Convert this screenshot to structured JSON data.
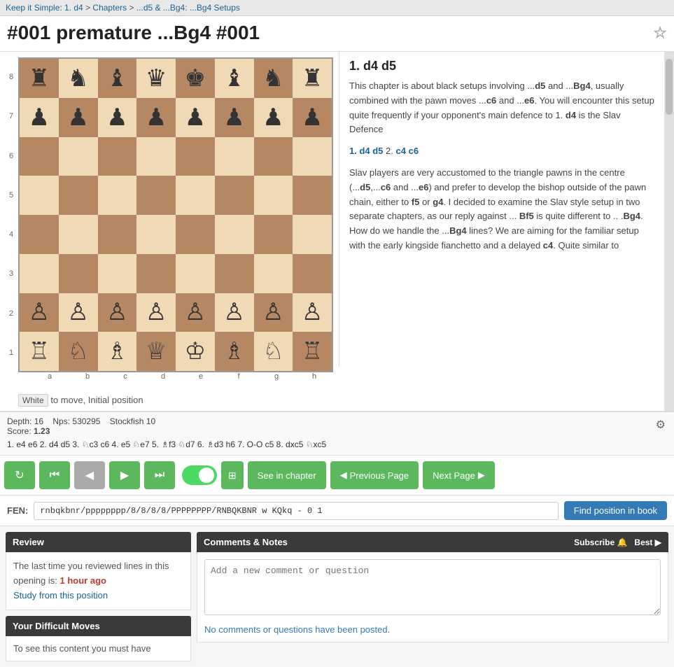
{
  "breadcrumb": {
    "items": [
      {
        "label": "Keep it Simple: 1. d4",
        "href": "#"
      },
      {
        "label": "Chapters",
        "href": "#"
      },
      {
        "label": "...d5 & ...Bg4: ...Bg4 Setups",
        "href": "#"
      }
    ],
    "separators": [
      " > ",
      " > "
    ]
  },
  "page": {
    "title": "#001 premature ...Bg4 #001",
    "star_label": "☆"
  },
  "board": {
    "status_color": "White",
    "status_text": "to move, Initial position",
    "col_labels": [
      "a",
      "b",
      "c",
      "d",
      "e",
      "f",
      "g",
      "h"
    ],
    "row_labels": [
      "8",
      "7",
      "6",
      "5",
      "4",
      "3",
      "2",
      "1"
    ]
  },
  "text_panel": {
    "move_header": "1. d4  d5",
    "paragraphs": [
      "This chapter is about black setups involving ...d5 and ...Bg4, usually combined with the pawn moves ...c6 and ...e6. You will encounter this setup quite frequently if your opponent's main defence to 1. d4 is the Slav Defence",
      "1. d4 d5  2. c4 c6",
      "Slav players are very accustomed to the triangle pawns in the centre (...d5,...c6 and ...e6) and prefer to develop the bishop outside of the pawn chain, either to f5 or g4. I decided to examine the Slav style setup in two separate chapters, as our reply against ... Bf5 is quite different to .. .Bg4. How do we handle the ...Bg4 lines? We are aiming for the familiar setup with the early kingside fianchetto and a delayed c4. Quite similar to"
    ]
  },
  "engine": {
    "depth_label": "Depth: 16",
    "nps_label": "Nps: 530295",
    "engine_name": "Stockfish 10",
    "score_label": "Score:",
    "score_value": "1.23",
    "line": "1. e4 e6 2. d4 d5 3. ♘c3 c6 4. e5 ♘e7 5. ♗f3 ♘d7 6. ♗d3 h6 7. O-O c5 8. dxc5 ♘xc5",
    "gear_icon": "⚙"
  },
  "controls": {
    "refresh_icon": "↻",
    "start_icon": "⏮",
    "prev_icon": "◀",
    "next_icon": "▶",
    "end_icon": "⏭",
    "toggle_on": true,
    "board_icon": "⊞",
    "see_chapter_label": "See in chapter",
    "prev_page_label": "◀ Previous Page",
    "next_page_label": "Next Page ▶"
  },
  "fen": {
    "label": "FEN:",
    "value": "rnbqkbnr/pppppppp/8/8/8/8/PPPPPPPP/RNBQKBNR w KQkq - 0 1",
    "find_btn_label": "Find position in book"
  },
  "review": {
    "header": "Review",
    "body_text": "The last time you reviewed lines in this opening is:",
    "time_highlight": "1 hour ago",
    "study_link": "Study from this position"
  },
  "difficult_moves": {
    "header": "Your Difficult Moves",
    "body_text": "To see this content you must have"
  },
  "comments": {
    "header": "Comments & Notes",
    "subscribe_label": "Subscribe 🔔",
    "best_label": "Best ▶",
    "placeholder": "Add a new comment or question",
    "no_comments": "No comments or questions have been posted."
  },
  "chess_pieces": {
    "black_rook": "♜",
    "black_knight": "♞",
    "black_bishop": "♝",
    "black_queen": "♛",
    "black_king": "♚",
    "black_pawn": "♟",
    "white_rook": "♖",
    "white_knight": "♘",
    "white_bishop": "♗",
    "white_queen": "♕",
    "white_king": "♔",
    "white_pawn": "♙"
  }
}
